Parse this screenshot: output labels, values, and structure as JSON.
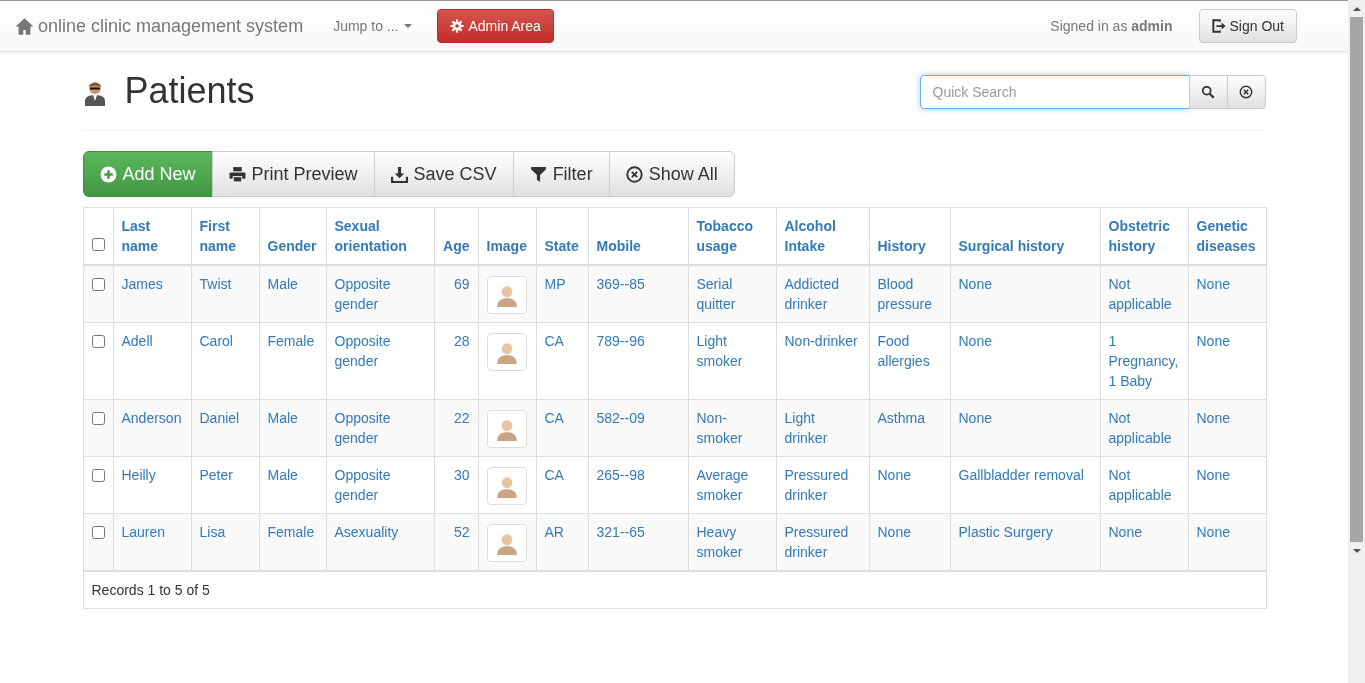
{
  "navbar": {
    "brand": "online clinic management system",
    "jump_menu": "Jump to ...",
    "admin_button": "Admin Area",
    "signed_in": "Signed in as **admin**",
    "sign_out": "Sign Out"
  },
  "page": {
    "title": "Patients",
    "search": {
      "placeholder": "Quick Search"
    }
  },
  "toolbar": [
    {
      "kind": "add",
      "label": "Add New"
    },
    {
      "kind": "print",
      "label": "Print Preview"
    },
    {
      "kind": "csv",
      "label": "Save CSV"
    },
    {
      "kind": "filter",
      "label": "Filter"
    },
    {
      "kind": "show_all",
      "label": "Show All"
    }
  ],
  "table": {
    "select_all": {
      "checked": false
    },
    "columns": [
      {
        "label": "Last name",
        "kind": "text"
      },
      {
        "label": "First name",
        "kind": "text"
      },
      {
        "label": "Gender",
        "kind": "text"
      },
      {
        "label": "Sexual orientation",
        "kind": "text"
      },
      {
        "label": "Age",
        "kind": "number"
      },
      {
        "label": "Image",
        "kind": "image"
      },
      {
        "label": "State",
        "kind": "text"
      },
      {
        "label": "Mobile",
        "kind": "text"
      },
      {
        "label": "Tobacco usage",
        "kind": "text"
      },
      {
        "label": "Alcohol Intake",
        "kind": "text"
      },
      {
        "label": "History",
        "kind": "text"
      },
      {
        "label": "Surgical history",
        "kind": "text"
      },
      {
        "label": "Obstetric history",
        "kind": "text"
      },
      {
        "label": "Genetic diseases",
        "kind": "text"
      }
    ],
    "rows": [
      {
        "checked": false,
        "cells": [
          "James",
          "Twist",
          "Male",
          "Opposite gender",
          "69",
          "",
          "MP",
          "369--85",
          "Serial quitter",
          "Addicted drinker",
          "Blood pressure",
          "None",
          "Not applicable",
          "None"
        ]
      },
      {
        "checked": false,
        "cells": [
          "Adell",
          "Carol",
          "Female",
          "Opposite gender",
          "28",
          "",
          "CA",
          "789--96",
          "Light smoker",
          "Non-drinker",
          "Food allergies",
          "None",
          "1 Pregnancy, 1 Baby",
          "None"
        ]
      },
      {
        "checked": false,
        "cells": [
          "Anderson",
          "Daniel",
          "Male",
          "Opposite gender",
          "22",
          "",
          "CA",
          "582--09",
          "Non-smoker",
          "Light drinker",
          "Asthma",
          "None",
          "Not applicable",
          "None"
        ]
      },
      {
        "checked": false,
        "cells": [
          "Heilly",
          "Peter",
          "Male",
          "Opposite gender",
          "30",
          "",
          "CA",
          "265--98",
          "Average smoker",
          "Pressured drinker",
          "None",
          "Gallbladder removal",
          "Not applicable",
          "None"
        ]
      },
      {
        "checked": false,
        "cells": [
          "Lauren",
          "Lisa",
          "Female",
          "Asexuality",
          "52",
          "",
          "AR",
          "321--65",
          "Heavy smoker",
          "Pressured drinker",
          "None",
          "Plastic Surgery",
          "None",
          "None"
        ]
      }
    ],
    "footer": "Records 1 to 5 of 5"
  }
}
